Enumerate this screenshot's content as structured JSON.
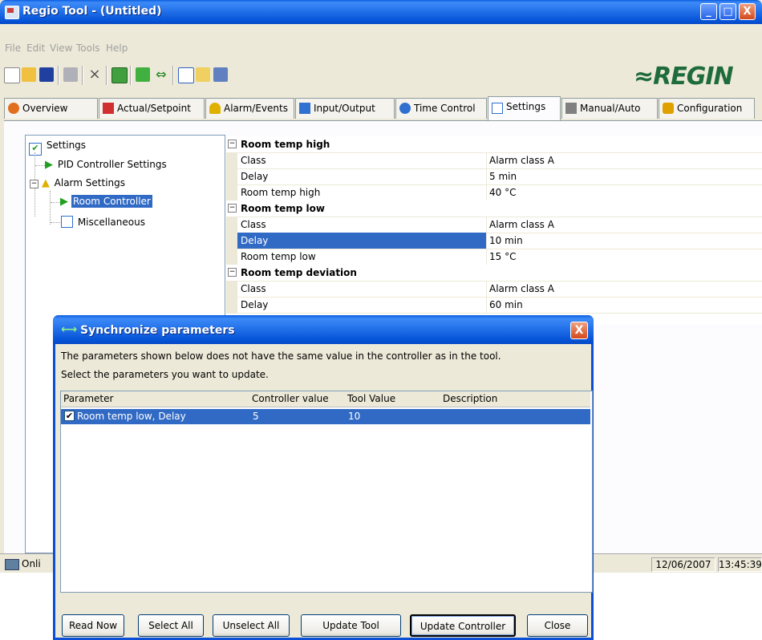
{
  "window": {
    "title": "Regio Tool - (Untitled)",
    "minimize": "_",
    "maximize": "□",
    "close": "X"
  },
  "menu": [
    "File",
    "Edit",
    "View",
    "Tools",
    "Help"
  ],
  "logo": "≈REGIN",
  "tabs": [
    {
      "label": "Overview",
      "icon": "overview-icon",
      "color": "#e07020"
    },
    {
      "label": "Actual/Setpoint",
      "icon": "setpoint-icon",
      "color": "#d03030"
    },
    {
      "label": "Alarm/Events",
      "icon": "alarm-bell-icon",
      "color": "#e0b000"
    },
    {
      "label": "Input/Output",
      "icon": "input-output-icon",
      "color": "#3070d0"
    },
    {
      "label": "Time Control",
      "icon": "clock-icon",
      "color": "#3070d0"
    },
    {
      "label": "Settings",
      "icon": "settings-check-icon",
      "color": "#3070d0"
    },
    {
      "label": "Manual/Auto",
      "icon": "hand-icon",
      "color": "#808080"
    },
    {
      "label": "Configuration",
      "icon": "configuration-icon",
      "color": "#e0a000"
    }
  ],
  "tree": [
    {
      "label": "Settings",
      "icon": "settings-check-icon"
    },
    {
      "label": "PID Controller Settings",
      "icon": "pid-arrow-icon"
    },
    {
      "label": "Alarm Settings",
      "icon": "alarm-bell-icon",
      "expander": "−"
    },
    {
      "label": "Room Controller",
      "icon": "pid-arrow-icon",
      "selected": true
    },
    {
      "label": "Miscellaneous",
      "icon": "list-icon"
    }
  ],
  "grid": [
    {
      "type": "category",
      "name": "Room temp high",
      "expander": "−"
    },
    {
      "name": "Class",
      "value": "Alarm class A"
    },
    {
      "name": "Delay",
      "value": "5 min"
    },
    {
      "name": "Room temp high",
      "value": "40 °C"
    },
    {
      "type": "category",
      "name": "Room temp low",
      "expander": "−"
    },
    {
      "name": "Class",
      "value": "Alarm class A"
    },
    {
      "name": "Delay",
      "value": "10 min",
      "selected": true
    },
    {
      "name": "Room temp low",
      "value": "15 °C"
    },
    {
      "type": "category",
      "name": "Room temp deviation",
      "expander": "−"
    },
    {
      "name": "Class",
      "value": "Alarm class A"
    },
    {
      "name": "Delay",
      "value": "60 min"
    }
  ],
  "status": {
    "connection": "Onli",
    "date": "12/06/2007",
    "time": "13:45:39"
  },
  "dialog": {
    "title": "Synchronize parameters",
    "close": "X",
    "line1": "The parameters shown below does not have the same value in the controller as in the tool.",
    "line2": "Select the parameters you want to update.",
    "columns": [
      "Parameter",
      "Controller value",
      "Tool Value",
      "Description"
    ],
    "rows": [
      {
        "parameter": "Room temp low, Delay",
        "controller_value": "5",
        "tool_value": "10",
        "description": "",
        "checked": true
      }
    ],
    "buttons": {
      "read_now": "Read Now",
      "select_all": "Select All",
      "unselect_all": "Unselect All",
      "update_tool": "Update Tool",
      "update_controller": "Update Controller",
      "close": "Close"
    }
  }
}
